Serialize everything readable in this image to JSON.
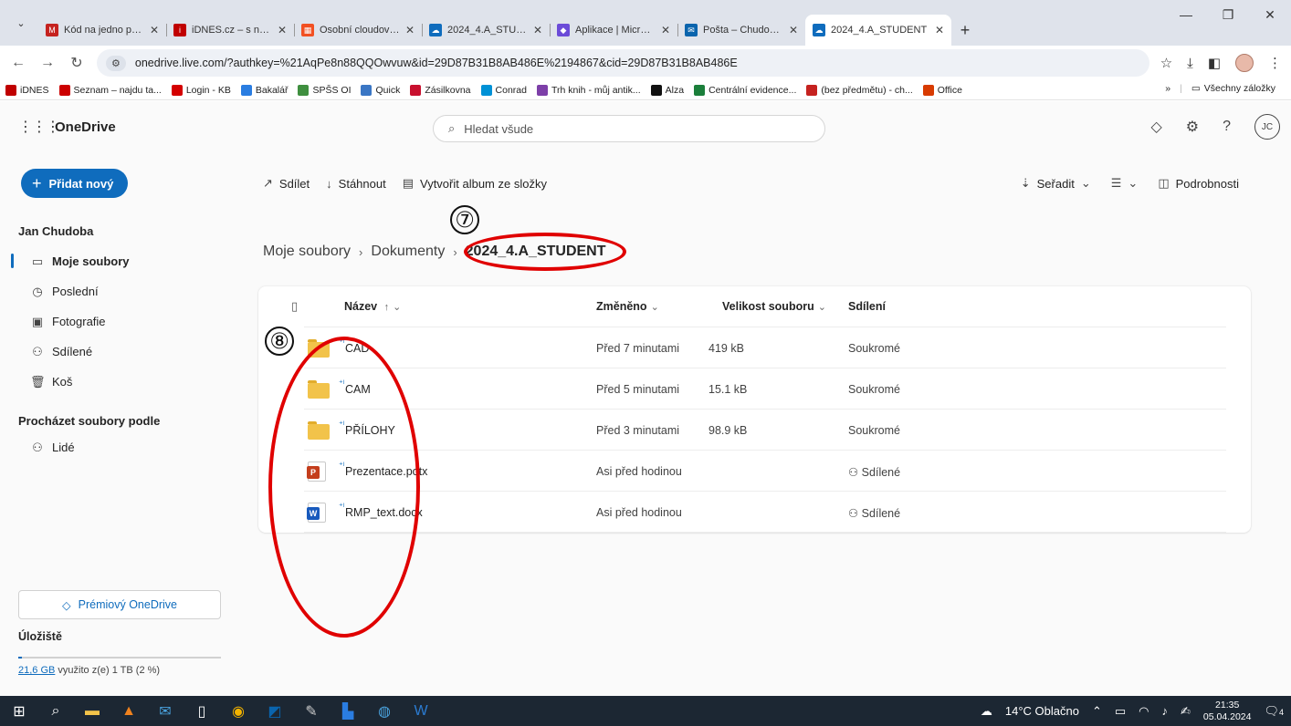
{
  "browser": {
    "tabs": [
      {
        "title": "Kód na jedno použití",
        "fav_color": "#c5221f",
        "glyph": "M"
      },
      {
        "title": "iDNES.cz – s námi víte více",
        "fav_color": "#c00000",
        "glyph": "i"
      },
      {
        "title": "Osobní cloudové úlož",
        "fav_color": "#f25022",
        "glyph": "▦"
      },
      {
        "title": "2024_4.A_STUDENT",
        "fav_color": "#0f6cbd",
        "glyph": "☁"
      },
      {
        "title": "Aplikace | Microsoft",
        "fav_color": "#6b4bd8",
        "glyph": "◆"
      },
      {
        "title": "Pošta – Chudoba Jan",
        "fav_color": "#0a64ad",
        "glyph": "✉"
      },
      {
        "title": "2024_4.A_STUDENT",
        "fav_color": "#0f6cbd",
        "glyph": "☁",
        "active": true
      }
    ],
    "url": "onedrive.live.com/?authkey=%21AqPe8n88QQOwvuw&id=29D87B31B8AB486E%2194867&cid=29D87B31B8AB486E",
    "bookmarks": [
      {
        "label": "iDNES",
        "color": "#c00000"
      },
      {
        "label": "Seznam – najdu ta...",
        "color": "#cc0000"
      },
      {
        "label": "Login - KB",
        "color": "#d40000"
      },
      {
        "label": "Bakalář",
        "color": "#2a7de1"
      },
      {
        "label": "SPŠS OI",
        "color": "#3f8f3f"
      },
      {
        "label": "Quick",
        "color": "#3a76c4"
      },
      {
        "label": "Zásilkovna",
        "color": "#c8102e"
      },
      {
        "label": "Conrad",
        "color": "#0091d6"
      },
      {
        "label": "Trh knih - můj antik...",
        "color": "#7d3fa8"
      },
      {
        "label": "Alza",
        "color": "#111111"
      },
      {
        "label": "Centrální evidence...",
        "color": "#1b7f3b"
      },
      {
        "label": "(bez předmětu) - ch...",
        "color": "#c5221f"
      },
      {
        "label": "Office",
        "color": "#d83b01"
      }
    ],
    "all_bookmarks": "Všechny záložky"
  },
  "app": {
    "title": "OneDrive",
    "search_placeholder": "Hledat všude",
    "initials": "JC"
  },
  "sidebar": {
    "add_new": "Přidat nový",
    "user": "Jan Chudoba",
    "items": [
      {
        "label": "Moje soubory",
        "icon": "▭",
        "active": true
      },
      {
        "label": "Poslední",
        "icon": "◷"
      },
      {
        "label": "Fotografie",
        "icon": "▣"
      },
      {
        "label": "Sdílené",
        "icon": "⚇"
      },
      {
        "label": "Koš",
        "icon": "🗑"
      }
    ],
    "browse_heading": "Procházet soubory podle",
    "people": "Lidé",
    "premium": "Prémiový OneDrive",
    "storage_heading": "Úložiště",
    "storage_used": "21,6 GB",
    "storage_rest": " využito z(e) 1 TB (2 %)",
    "storage_fraction": 0.02
  },
  "commands": {
    "share": "Sdílet",
    "download": "Stáhnout",
    "album": "Vytvořit album ze složky",
    "sort": "Seřadit",
    "details": "Podrobnosti"
  },
  "breadcrumb": {
    "root": "Moje soubory",
    "parent": "Dokumenty",
    "current": "2024_4.A_STUDENT"
  },
  "table": {
    "headers": {
      "name": "Název",
      "name_sort": "↑",
      "modified": "Změněno",
      "size": "Velikost souboru",
      "sharing": "Sdílení"
    },
    "rows": [
      {
        "type": "folder",
        "name": "CAD",
        "modified": "Před 7 minutami",
        "size": "419 kB",
        "sharing": "Soukromé"
      },
      {
        "type": "folder",
        "name": "CAM",
        "modified": "Před 5 minutami",
        "size": "15.1 kB",
        "sharing": "Soukromé"
      },
      {
        "type": "folder",
        "name": "PŘÍLOHY",
        "modified": "Před 3 minutami",
        "size": "98.9 kB",
        "sharing": "Soukromé"
      },
      {
        "type": "pptx",
        "name": "Prezentace.potx",
        "modified": "Asi před hodinou",
        "size": "",
        "sharing": "⚇ Sdílené"
      },
      {
        "type": "docx",
        "name": "RMP_text.docx",
        "modified": "Asi před hodinou",
        "size": "",
        "sharing": "⚇ Sdílené"
      }
    ]
  },
  "annotations": {
    "seven": "⑦",
    "eight": "⑧",
    "color": "#e00000"
  },
  "taskbar": {
    "weather": "14°C Oblačno",
    "time": "21:35",
    "date": "05.04.2024",
    "notif_count": "4"
  }
}
